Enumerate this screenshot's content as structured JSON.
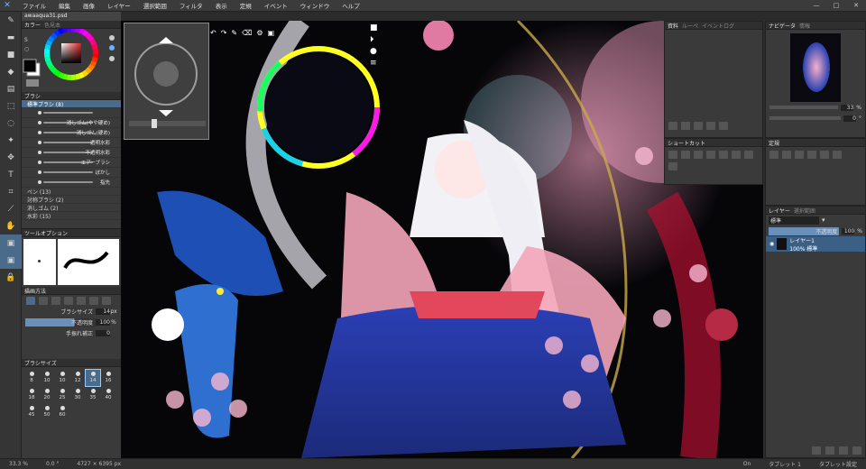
{
  "menu": {
    "items": [
      "ファイル",
      "編集",
      "画像",
      "レイヤー",
      "選択範囲",
      "フィルタ",
      "表示",
      "定規",
      "イベント",
      "ウィンドウ",
      "ヘルプ"
    ]
  },
  "file": {
    "tab": "awaaqua31.psd"
  },
  "left": {
    "color_tabs": [
      "カラー",
      "色見本"
    ],
    "brush_header": "ブラシ",
    "brush_groups": [
      {
        "label": "標準ブラシ (8)",
        "selected": true
      }
    ],
    "brush_items": [
      "",
      "消しゴム(やや硬め)",
      "消しゴム(硬め)",
      "透明水彩",
      "不透明水彩",
      "エアーブラシ",
      "ぼかし",
      "指先"
    ],
    "brush_groups_more": [
      "ペン (13)",
      "対称ブラシ (2)",
      "消しゴム (2)",
      "水彩 (15)"
    ],
    "tool_option_header": "ツールオプション",
    "drawing_method_header": "描画方法",
    "brush_size_label": "ブラシサイズ",
    "brush_size_value": "14",
    "brush_size_unit": "px",
    "opacity_label": "不透明度",
    "opacity_value": "100",
    "opacity_unit": "%",
    "correction_label": "手振れ補正",
    "correction_value": "0",
    "size_panel_header": "ブラシサイズ",
    "sizes": [
      "8",
      "10",
      "10",
      "12",
      "14",
      "16",
      "18",
      "20",
      "25",
      "30",
      "35",
      "40",
      "45",
      "50",
      "60"
    ],
    "selected_size": "14"
  },
  "right": {
    "nav_tabs": [
      "資料",
      "ルーペ",
      "イベントログ"
    ],
    "navigator_tabs": [
      "ナビゲータ",
      "情報"
    ],
    "zoom_value": "33",
    "zoom_unit": "%",
    "angle_value": "0",
    "angle_unit": "°",
    "shortcut_header": "ショートカット",
    "textures_header": "定規",
    "layers_tabs": [
      "レイヤー",
      "選択範囲"
    ],
    "blend_mode": "標準",
    "opacity_label": "不透明度",
    "layer_opacity": "100",
    "layer_opacity_unit": "%",
    "layer_name": "レイヤー1",
    "layer_desc": "100% 標準"
  },
  "status": {
    "zoom": "33.3 %",
    "angle": "0.0 °",
    "size": "4727 × 6395 px",
    "on": "On",
    "tablet": "タブレット 1",
    "tablet_setting": "タブレット設定"
  },
  "colors": {
    "accent": "#4a6b8a",
    "primary": "#000000",
    "secondary": "#ffffff",
    "pink_circle": "#e07aa3",
    "red_circle": "#b72a46"
  }
}
